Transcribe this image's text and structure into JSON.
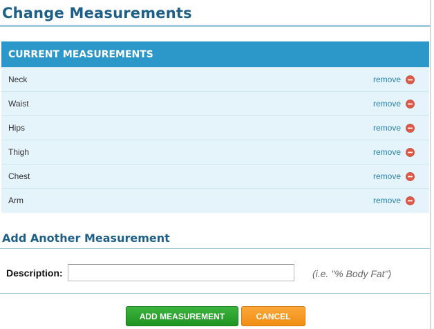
{
  "header": {
    "title": "Change Measurements"
  },
  "current": {
    "heading": "CURRENT MEASUREMENTS",
    "remove_label": "remove",
    "items": [
      {
        "label": "Neck"
      },
      {
        "label": "Waist"
      },
      {
        "label": "Hips"
      },
      {
        "label": "Thigh"
      },
      {
        "label": "Chest"
      },
      {
        "label": "Arm"
      }
    ]
  },
  "add_section": {
    "title": "Add Another Measurement",
    "description_label": "Description:",
    "description_value": "",
    "hint": "(i.e. \"% Body Fat\")"
  },
  "actions": {
    "add_label": "ADD MEASUREMENT",
    "cancel_label": "CANCEL"
  },
  "colors": {
    "heading_text": "#1d5f86",
    "panel_header": "#2c97c9",
    "panel_body": "#e5f4fb",
    "remove_icon": "#e05a47",
    "add_button": "#2fa531",
    "cancel_button": "#f59a22"
  },
  "icons": {
    "remove": "minus-circle-icon"
  }
}
